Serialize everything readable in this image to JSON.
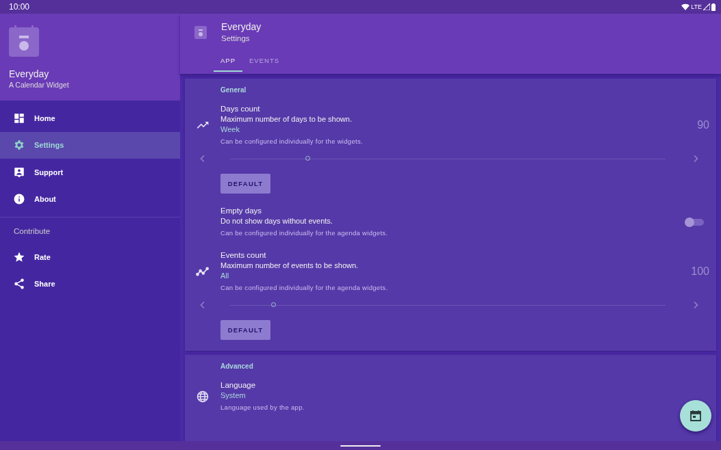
{
  "status_bar": {
    "time": "10:00",
    "network": "LTE"
  },
  "drawer": {
    "app_name": "Everyday",
    "app_subtitle": "A Calendar Widget",
    "items": [
      {
        "label": "Home",
        "selected": false
      },
      {
        "label": "Settings",
        "selected": true
      },
      {
        "label": "Support",
        "selected": false
      },
      {
        "label": "About",
        "selected": false
      }
    ],
    "section_title": "Contribute",
    "contribute_items": [
      {
        "label": "Rate",
        "selected": false
      },
      {
        "label": "Share",
        "selected": false
      }
    ]
  },
  "toolbar": {
    "title": "Everyday",
    "subtitle": "Settings",
    "tabs": [
      {
        "label": "APP",
        "selected": true
      },
      {
        "label": "EVENTS",
        "selected": false
      }
    ]
  },
  "sections": [
    {
      "title": "General",
      "settings": [
        {
          "kind": "slider",
          "title": "Days count",
          "summary": "Maximum number of days to be shown.",
          "value": "Week",
          "note": "Can be configured individually for the widgets.",
          "reading": "90",
          "level": 0.18,
          "button": "DEFAULT"
        },
        {
          "kind": "switch",
          "title": "Empty days",
          "summary": "Do not show days without events.",
          "note": "Can be configured individually for the agenda widgets.",
          "on": false
        },
        {
          "kind": "slider",
          "title": "Events count",
          "summary": "Maximum number of events to be shown.",
          "value": "All",
          "note": "Can be configured individually for the agenda widgets.",
          "reading": "100",
          "level": 0.1,
          "button": "DEFAULT"
        }
      ]
    },
    {
      "title": "Advanced",
      "settings": [
        {
          "kind": "choice",
          "title": "Language",
          "value": "System",
          "note": "Language used by the app."
        }
      ]
    }
  ]
}
